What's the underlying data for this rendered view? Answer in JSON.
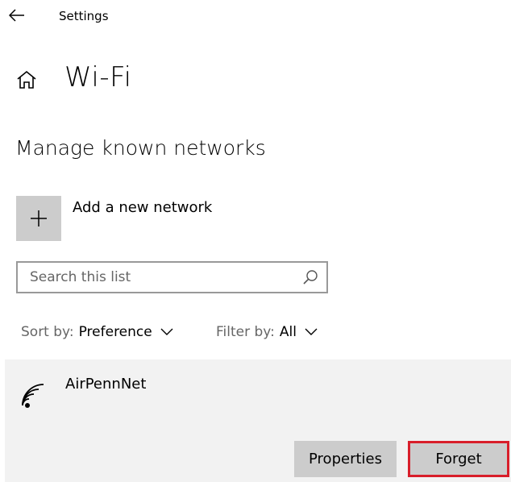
{
  "window": {
    "title": "Settings",
    "back_icon": "back-arrow-icon"
  },
  "page": {
    "home_icon": "home-icon",
    "title": "Wi-Fi",
    "section_title": "Manage known networks"
  },
  "add_network": {
    "icon": "plus-icon",
    "label": "Add a new network"
  },
  "search": {
    "placeholder": "Search this list",
    "value": "",
    "icon": "search-icon"
  },
  "sort": {
    "label": "Sort by:",
    "value": "Preference"
  },
  "filter": {
    "label": "Filter by:",
    "value": "All"
  },
  "networks": [
    {
      "name": "AirPennNet",
      "icon": "wifi-signal-icon",
      "properties_label": "Properties",
      "forget_label": "Forget"
    }
  ],
  "colors": {
    "tile_gray": "#cccccc",
    "item_background": "#f2f2f2",
    "highlight_red": "#d81e2a",
    "muted_text": "#666666"
  }
}
